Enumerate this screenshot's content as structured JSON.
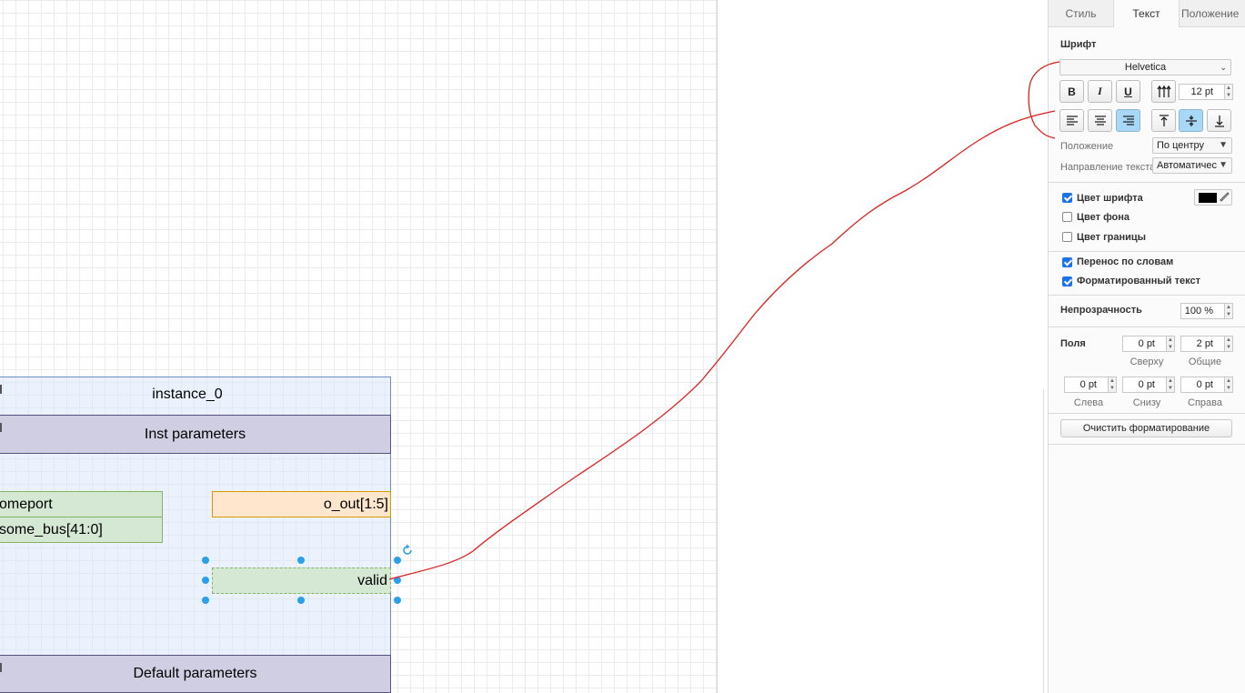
{
  "canvas": {
    "instance": {
      "title": "instance_0",
      "inst_parameters": "Inst parameters",
      "default_parameters": "Default parameters",
      "ports_left": [
        "omeport",
        "some_bus[41:0]"
      ],
      "port_out": "o_out[1:5]",
      "port_valid": "valid"
    },
    "rotate_icon": "rotate-icon"
  },
  "panel": {
    "tabs": [
      "Стиль",
      "Текст",
      "Положение"
    ],
    "active_tab": "Текст",
    "font_section_label": "Шрифт",
    "font_family": "Helvetica",
    "bold_label": "B",
    "italic_label": "I",
    "underline_label": "U",
    "font_size": "12 pt",
    "position_label": "Положение",
    "position_value": "По центру",
    "direction_label": "Направление текста",
    "direction_value": "Автоматически",
    "font_color_label": "Цвет шрифта",
    "font_color": "#000000",
    "background_color_label": "Цвет фона",
    "border_color_label": "Цвет границы",
    "word_wrap_label": "Перенос по словам",
    "formatted_text_label": "Форматированный текст",
    "opacity_label": "Непрозрачность",
    "opacity_value": "100 %",
    "margins_label": "Поля",
    "top_value": "0 pt",
    "top_label": "Сверху",
    "global_value": "2 pt",
    "global_label": "Общие",
    "left_value": "0 pt",
    "left_label": "Слева",
    "bottom_value": "0 pt",
    "bottom_label": "Снизу",
    "right_value": "0 pt",
    "right_label": "Справа",
    "clear_button": "Очистить форматирование",
    "checks": {
      "font_color": true,
      "background_color": false,
      "border_color": false,
      "word_wrap": true,
      "formatted_text": true
    }
  },
  "colors": {
    "selection": "#29a0ec",
    "annotation": "#e02020",
    "active_toggle": "#a9d8f6"
  }
}
